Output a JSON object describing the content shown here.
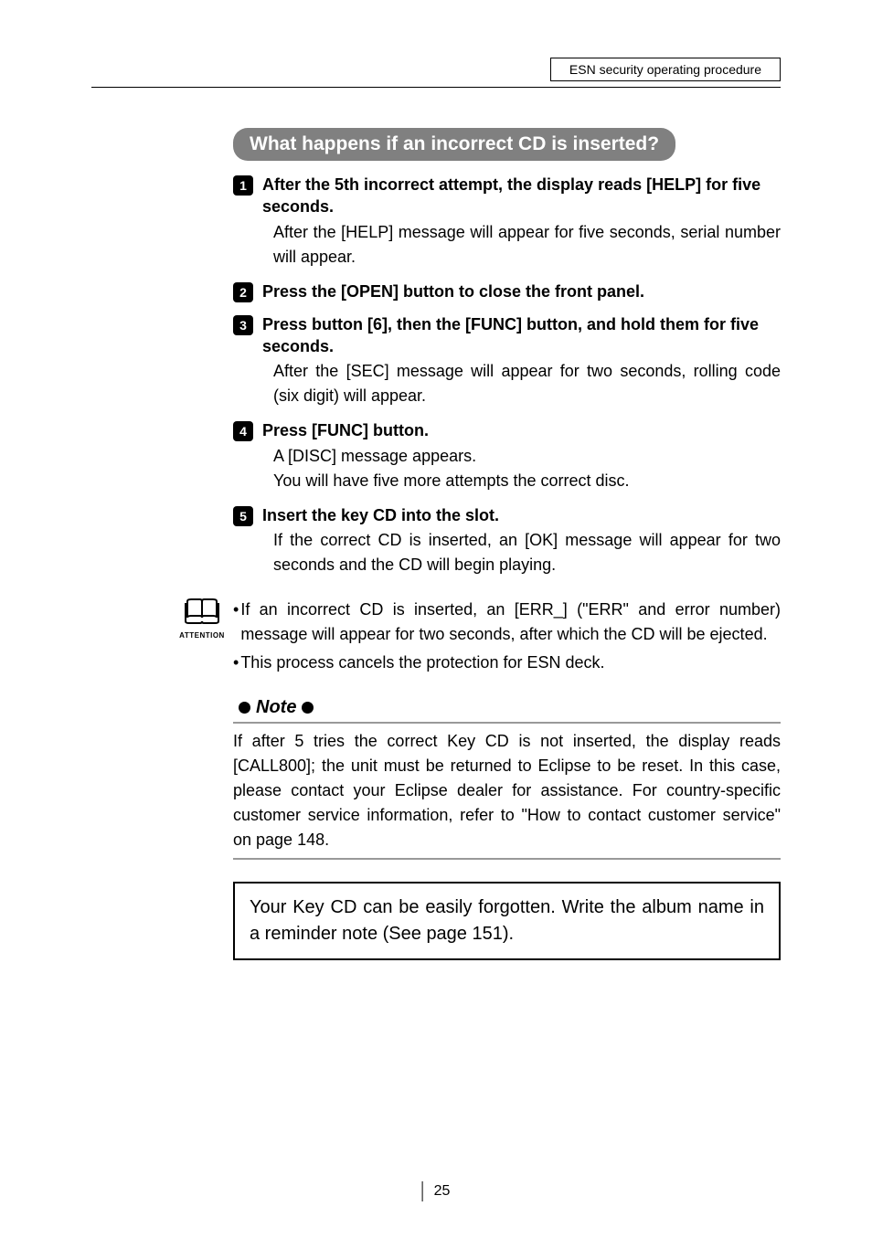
{
  "header": {
    "box_text": "ESN security operating procedure"
  },
  "section_title": "What happens if an incorrect CD is inserted?",
  "steps": [
    {
      "num": "1",
      "title": "After the 5th incorrect attempt, the display reads [HELP] for five seconds.",
      "desc": "After the [HELP] message will appear for five seconds, serial number will appear."
    },
    {
      "num": "2",
      "title": "Press the [OPEN] button to close the front panel.",
      "desc": ""
    },
    {
      "num": "3",
      "title": "Press button [6], then the [FUNC] button, and hold them for five seconds.",
      "desc": "After the [SEC] message will appear for two seconds, rolling code (six digit) will appear."
    },
    {
      "num": "4",
      "title": "Press [FUNC] button.",
      "desc": "A [DISC] message appears.\nYou will have five more attempts the correct disc."
    },
    {
      "num": "5",
      "title": "Insert the key CD into the slot.",
      "desc": "If the correct CD is inserted, an [OK] message will appear for two seconds and the CD will begin playing."
    }
  ],
  "attention": {
    "label": "ATTENTION",
    "bullets": [
      "If an incorrect CD is inserted, an [ERR_] (\"ERR\" and error number) message will appear for two seconds, after which the CD will be ejected.",
      "This process cancels the protection for ESN deck."
    ]
  },
  "note": {
    "label": "Note",
    "body": "If after 5 tries the correct Key CD is not inserted, the display reads [CALL800]; the unit must be returned to Eclipse to be reset. In this case, please contact your Eclipse dealer for assistance. For country-specific customer service information, refer to  \"How to contact customer service\" on page 148."
  },
  "reminder": "Your Key CD can be easily forgotten. Write the album name in a reminder note (See page 151).",
  "page_number": "25"
}
